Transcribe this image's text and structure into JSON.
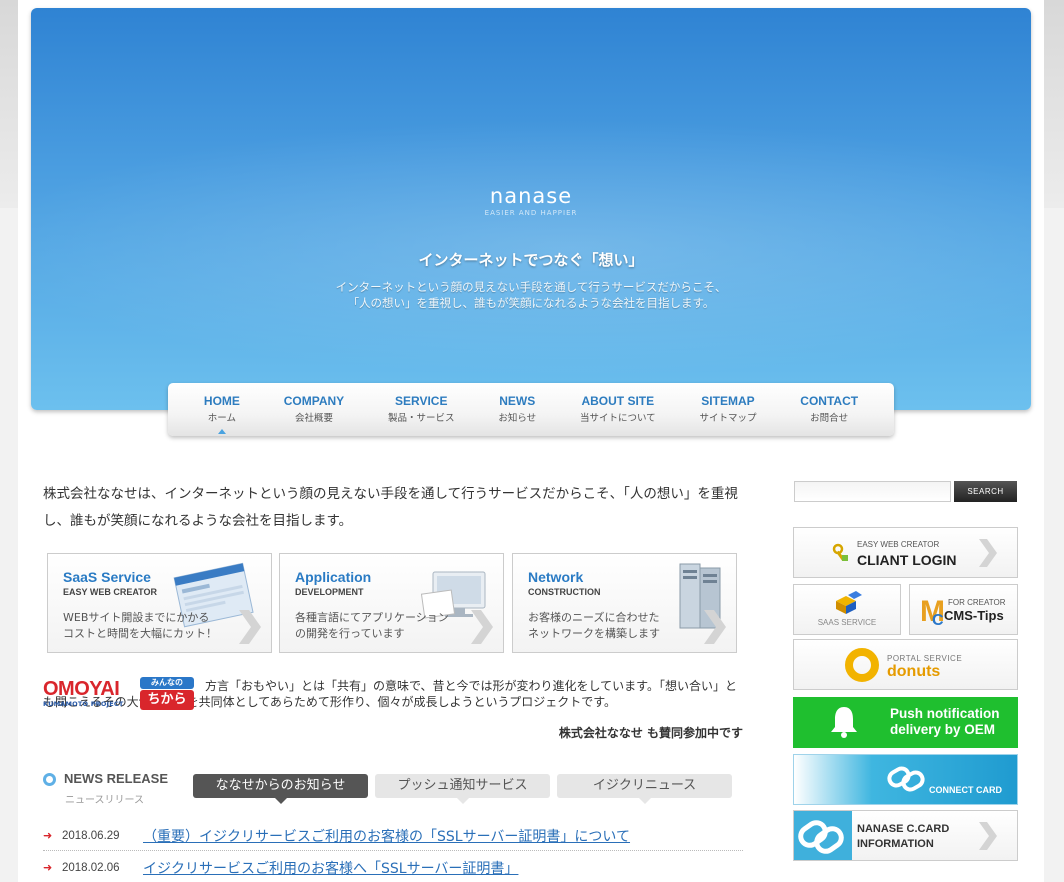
{
  "hero": {
    "logo": "nanase",
    "tagline": "EASIER AND HAPPIER",
    "heading": "インターネットでつなぐ「想い」",
    "line1": "インターネットという顔の見えない手段を通して行うサービスだからこそ、",
    "line2": "「人の想い」を重視し、誰もが笑顔になれるような会社を目指します。"
  },
  "nav": [
    {
      "en": "HOME",
      "jp": "ホーム"
    },
    {
      "en": "COMPANY",
      "jp": "会社概要"
    },
    {
      "en": "SERVICE",
      "jp": "製品・サービス"
    },
    {
      "en": "NEWS",
      "jp": "お知らせ"
    },
    {
      "en": "ABOUT SITE",
      "jp": "当サイトについて"
    },
    {
      "en": "SITEMAP",
      "jp": "サイトマップ"
    },
    {
      "en": "CONTACT",
      "jp": "お問合せ"
    }
  ],
  "intro": "株式会社ななせは、インターネットという顔の見えない手段を通して行うサービスだからこそ、「人の想い」を重視し、誰もが笑顔になれるような会社を目指します。",
  "services": [
    {
      "title": "SaaS Service",
      "sub": "EASY WEB CREATOR",
      "desc1": "WEBサイト開設までにかかる",
      "desc2": "コストと時間を大幅にカット！"
    },
    {
      "title": "Application",
      "sub": "DEVELOPMENT",
      "desc1": "各種言語にてアプリケーション",
      "desc2": "の開発を行っています"
    },
    {
      "title": "Network",
      "sub": "CONSTRUCTION",
      "desc1": "お客様のニーズに合わせた",
      "desc2": "ネットワークを構築します"
    }
  ],
  "omoyai": {
    "logo": "OMOYAI",
    "logo_sub": "KUMAMOTO PROJECT",
    "badge_top": "みんなの",
    "badge_bottom": "ちから",
    "text": "方言「おもやい」とは「共有」の意味で、昔と今では形が変わり進化をしています。「想い合い」とも聞こえるその大切な部分を共同体としてあらためて形作り、個々が成長しようというプロジェクトです。",
    "sign": "株式会社ななせ も賛同参加中です"
  },
  "news": {
    "heading_en": "NEWS RELEASE",
    "heading_jp": "ニュースリリース",
    "tabs": [
      "ななせからのお知らせ",
      "プッシュ通知サービス",
      "イジクリニュース"
    ],
    "items": [
      {
        "date": "2018.06.29",
        "title": "（重要）イジクリサービスご利用のお客様の「SSLサーバー証明書」について"
      },
      {
        "date": "2018.02.06",
        "title": "イジクリサービスご利用のお客様へ「SSLサーバー証明書」"
      }
    ]
  },
  "sidebar": {
    "search_placeholder": "",
    "search_button": "SEARCH",
    "client_login_small": "EASY WEB CREATOR",
    "client_login_big": "CLIANT LOGIN",
    "saas_label": "SAAS SERVICE",
    "cms_small": "FOR CREATOR",
    "cms_big": "CMS-Tips",
    "donuts_small": "PORTAL SERVICE",
    "donuts_big": "donuts",
    "push_line1": "Push notification",
    "push_line2": "delivery by OEM",
    "connect_card": "CONNECT CARD",
    "ccard_line1": "NANASE C.CARD",
    "ccard_line2": "INFORMATION"
  },
  "colors": {
    "accent_blue": "#2d7cbf",
    "brand_red": "#d9262c",
    "push_green": "#1fbf2f",
    "connect_blue": "#29a8d8"
  }
}
